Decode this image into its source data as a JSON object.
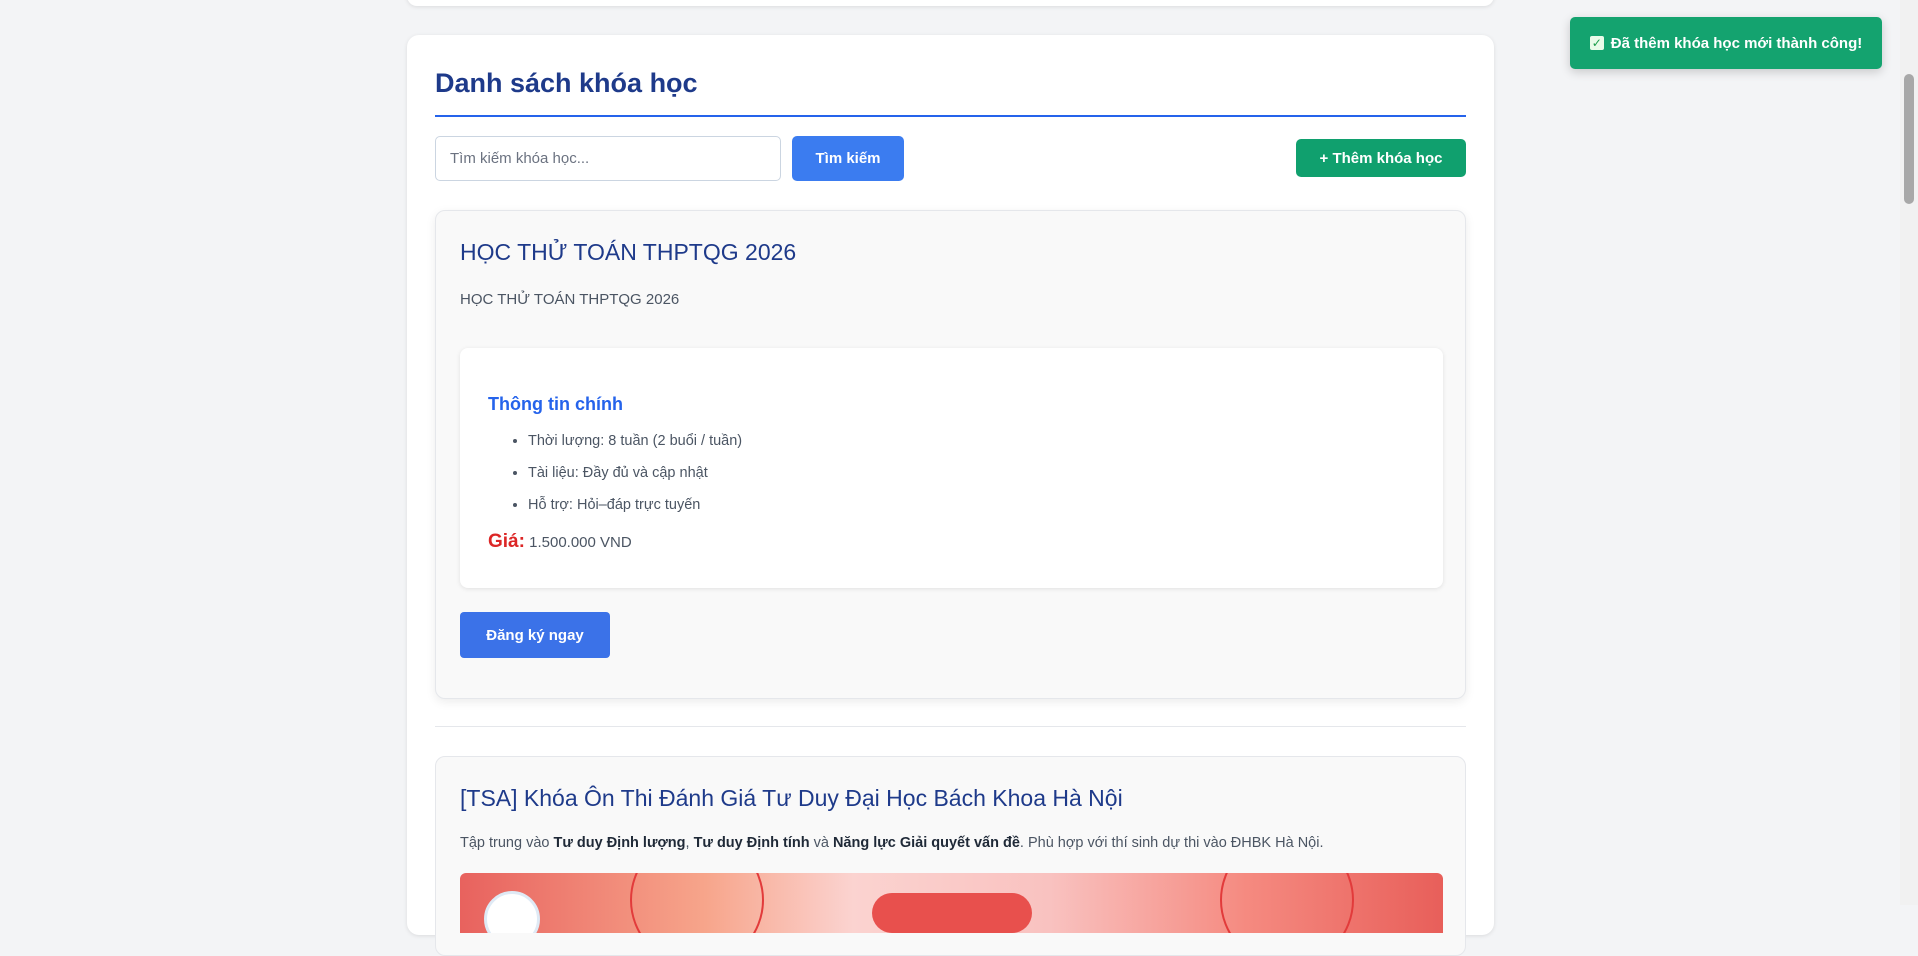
{
  "section": {
    "title": "Danh sách khóa học"
  },
  "search": {
    "placeholder": "Tìm kiếm khóa học...",
    "button_label": "Tìm kiếm"
  },
  "add_course_button": "+ Thêm khóa học",
  "courses": [
    {
      "title": "HỌC THỬ TOÁN THPTQG 2026",
      "description": "HỌC THỬ TOÁN THPTQG 2026",
      "info_heading": "Thông tin chính",
      "info_items": [
        "Thời lượng: 8 tuần (2 buổi / tuần)",
        "Tài liệu: Đầy đủ và cập nhật",
        "Hỗ trợ: Hỏi–đáp trực tuyến"
      ],
      "price_label": "Giá:",
      "price_value": "1.500.000 VND",
      "register_label": "Đăng ký ngay"
    },
    {
      "title": "[TSA] Khóa Ôn Thi Đánh Giá Tư Duy Đại Học Bách Khoa Hà Nội",
      "description_parts": {
        "p1": "Tập trung vào ",
        "b1": "Tư duy Định lượng",
        "p2": ", ",
        "b2": "Tư duy Định tính",
        "p3": " và ",
        "b3": "Năng lực Giải quyết vấn đề",
        "p4": ". Phù hợp với thí sinh dự thi vào ĐHBK Hà Nội."
      }
    }
  ],
  "toast": {
    "message": "Đã thêm khóa học mới thành công!",
    "icon": "check-icon"
  },
  "colors": {
    "title": "#1e3a8a",
    "accent": "#2563eb",
    "success": "#10a06e",
    "price": "#dc2626"
  }
}
